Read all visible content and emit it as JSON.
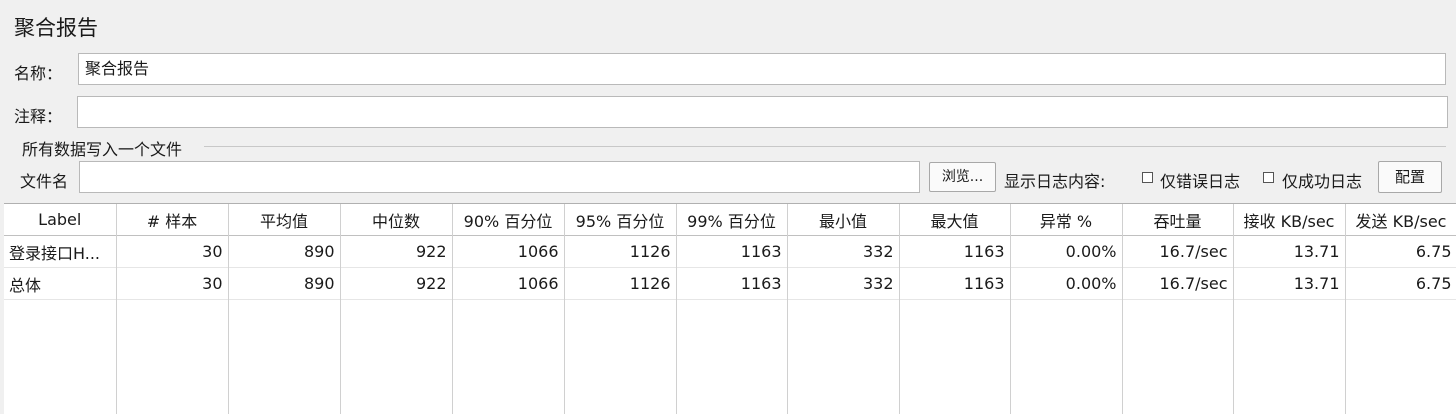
{
  "title": "聚合报告",
  "name_label": "名称：",
  "name_value": "聚合报告",
  "comment_label": "注释：",
  "comment_value": "",
  "file_group_label": "所有数据写入一个文件",
  "filename_label": "文件名",
  "filename_value": "",
  "browse_label": "浏览...",
  "log_content_label": "显示日志内容:",
  "errors_only_label": "仅错误日志",
  "errors_only_checked": false,
  "success_only_label": "仅成功日志",
  "success_only_checked": false,
  "configure_label": "配置",
  "table": {
    "headers": [
      "Label",
      "# 样本",
      "平均值",
      "中位数",
      "90% 百分位",
      "95% 百分位",
      "99% 百分位",
      "最小值",
      "最大值",
      "异常 %",
      "吞吐量",
      "接收 KB/sec",
      "发送 KB/sec"
    ],
    "rows": [
      [
        "登录接口H...",
        "30",
        "890",
        "922",
        "1066",
        "1126",
        "1163",
        "332",
        "1163",
        "0.00%",
        "16.7/sec",
        "13.71",
        "6.75"
      ],
      [
        "总体",
        "30",
        "890",
        "922",
        "1066",
        "1126",
        "1163",
        "332",
        "1163",
        "0.00%",
        "16.7/sec",
        "13.71",
        "6.75"
      ]
    ]
  }
}
